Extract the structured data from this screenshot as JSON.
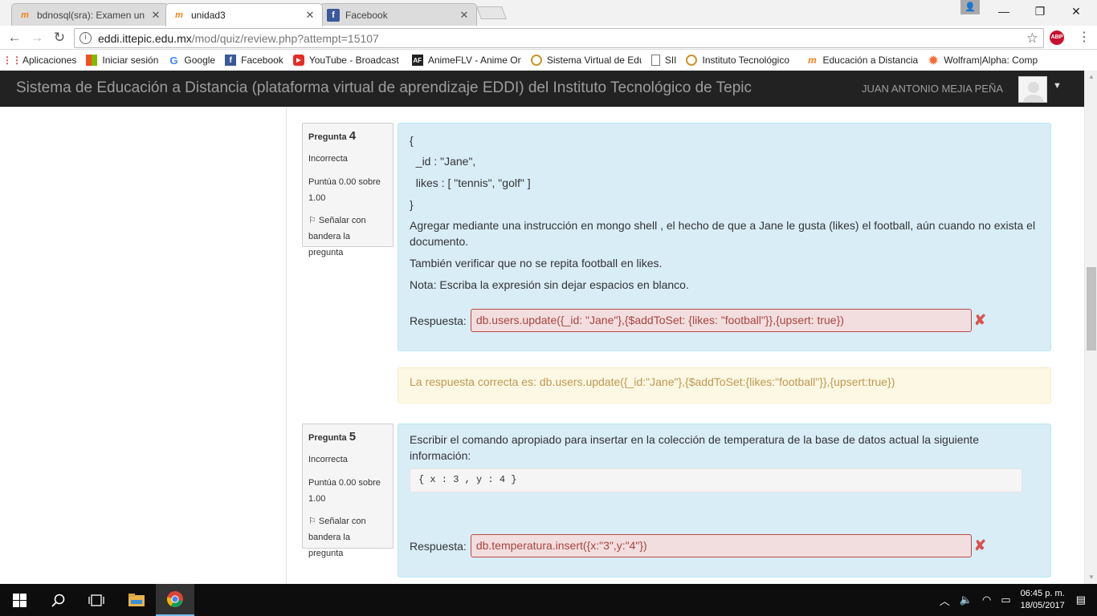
{
  "browser": {
    "tabs": [
      {
        "label": "bdnosql(sra): Examen un",
        "favicon": "moodle",
        "active": false
      },
      {
        "label": "unidad3",
        "favicon": "moodle",
        "active": true
      },
      {
        "label": "Facebook",
        "favicon": "facebook",
        "active": false
      }
    ],
    "url_host": "eddi.ittepic.edu.mx",
    "url_path": "/mod/quiz/review.php?attempt=15107",
    "bookmarks": [
      {
        "label": "Aplicaciones",
        "icon": "apps-grid-icon"
      },
      {
        "label": "Iniciar sesión",
        "icon": "windows-icon"
      },
      {
        "label": "Google",
        "icon": "google-icon"
      },
      {
        "label": "Facebook",
        "icon": "facebook-icon"
      },
      {
        "label": "YouTube - Broadcast",
        "icon": "youtube-icon"
      },
      {
        "label": "AnimeFLV - Anime On",
        "icon": "animeflv-icon"
      },
      {
        "label": "Sistema Virtual de Edu",
        "icon": "ittepic-seal-icon"
      },
      {
        "label": "SII",
        "icon": "page-icon"
      },
      {
        "label": "Instituto Tecnológico",
        "icon": "ittepic-seal-icon"
      },
      {
        "label": "Educación a Distancia",
        "icon": "moodle-icon"
      },
      {
        "label": "Wolfram|Alpha: Comp",
        "icon": "wolfram-icon"
      }
    ],
    "abp_label": "ABP"
  },
  "site": {
    "title": "Sistema de Educación a Distancia (plataforma virtual de aprendizaje EDDI) del Instituto Tecnológico de Tepic",
    "user": "JUAN ANTONIO MEJIA PEÑA"
  },
  "q4": {
    "label": "Pregunta",
    "number": "4",
    "state": "Incorrecta",
    "grade_line1": "Puntúa 0.00 sobre",
    "grade_line2": "1.00",
    "flag_line1": "Señalar con",
    "flag_line2": "bandera la pregunta",
    "code_lines": [
      "{",
      "  _id : \"Jane\",",
      "  likes : [ \"tennis\", \"golf\" ]",
      "}"
    ],
    "text1": "Agregar mediante una instrucción en mongo shell , el hecho de que a Jane le gusta (likes) el football, aún cuando no exista el documento.",
    "text2": "También verificar que no se repita football en likes.",
    "text3": "Nota: Escriba la expresión sin dejar espacios en blanco.",
    "answer_label": "Respuesta:",
    "answer": "db.users.update({_id: \"Jane\"},{$addToSet: {likes: \"football\"}},{upsert: true})",
    "right_answer": "La respuesta correcta es: db.users.update({_id:\"Jane\"},{$addToSet:{likes:\"football\"}},{upsert:true})"
  },
  "q5": {
    "label": "Pregunta",
    "number": "5",
    "state": "Incorrecta",
    "grade_line1": "Puntúa 0.00 sobre",
    "grade_line2": "1.00",
    "flag_line1": "Señalar con",
    "flag_line2": "bandera la pregunta",
    "text1": "Escribir el comando apropiado para insertar en la colección de temperatura de la base de datos actual la siguiente información:",
    "code": "{ x : 3 , y : 4 }",
    "answer_label": "Respuesta:",
    "answer": "db.temperatura.insert({x:\"3\",y:\"4\"})"
  },
  "taskbar": {
    "time": "06:45 p. m.",
    "date": "18/05/2017"
  },
  "colors": {
    "header_bg": "#222222",
    "question_bg": "#d9edf7",
    "incorrect_bg": "#f2dede",
    "incorrect_text": "#a94442",
    "feedback_bg": "#fcf8e3",
    "feedback_text": "#c09853"
  }
}
